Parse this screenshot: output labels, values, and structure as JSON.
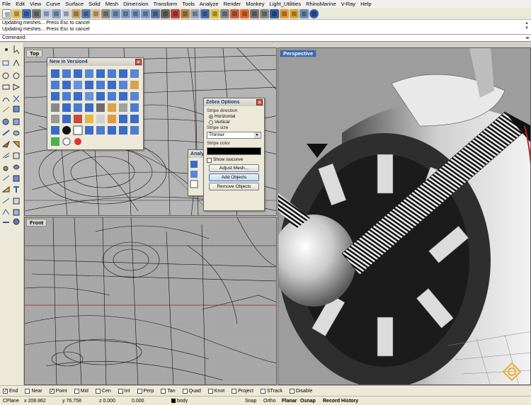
{
  "menu": [
    "File",
    "Edit",
    "View",
    "Curve",
    "Surface",
    "Solid",
    "Mesh",
    "Dimension",
    "Transform",
    "Tools",
    "Analyze",
    "Render",
    "Monkey",
    "Light_Utilities",
    "RhinoMarine",
    "V-Ray",
    "Help"
  ],
  "history": {
    "line1": "Updating meshes... Press Esc to cancel",
    "line2": "Updating meshes... Press Esc to cancel"
  },
  "command": {
    "label": "Command:"
  },
  "viewports": {
    "top": {
      "title": "Top"
    },
    "front": {
      "title": "Front"
    },
    "perspective": {
      "title": "Perspective"
    }
  },
  "panels": {
    "new_in_v4": {
      "title": "New in Version4"
    },
    "analysis": {
      "title": "Analy"
    },
    "zebra": {
      "title": "Zebra Options",
      "stripe_direction_label": "Stripe direction",
      "horizontal_label": "Horizontal",
      "vertical_label": "Vertical",
      "stripe_size_label": "Stripe size",
      "stripe_size_value": "Thinner",
      "stripe_color_label": "Stripe color",
      "stripe_color": "#000000",
      "show_isocurve_label": "Show isocurve",
      "adjust_mesh_label": "Adjust Mesh...",
      "add_objects_label": "Add Objects",
      "remove_objects_label": "Remove Objects"
    }
  },
  "osnaps": [
    {
      "label": "End",
      "checked": true
    },
    {
      "label": "Near",
      "checked": false
    },
    {
      "label": "Point",
      "checked": true
    },
    {
      "label": "Mid",
      "checked": false
    },
    {
      "label": "Cen",
      "checked": false
    },
    {
      "label": "Int",
      "checked": false
    },
    {
      "label": "Perp",
      "checked": false
    },
    {
      "label": "Tan",
      "checked": false
    },
    {
      "label": "Quad",
      "checked": false
    },
    {
      "label": "Knot",
      "checked": false
    },
    {
      "label": "Project",
      "checked": false
    },
    {
      "label": "STrack",
      "checked": false
    },
    {
      "label": "Disable",
      "checked": false
    }
  ],
  "coords": {
    "cplane": "CPlane",
    "x": "x 208.862",
    "y": "y 76.758",
    "z": "z 0.000",
    "d": "0.000",
    "layer": "body",
    "snap": "Snap",
    "ortho": "Ortho",
    "planar": "Planar",
    "osnap": "Osnap",
    "record": "Record History"
  },
  "colors": {
    "active_title": "#3c68b3",
    "viewport_bg": "#a9a9a9",
    "ui_bg": "#ece9d8"
  }
}
